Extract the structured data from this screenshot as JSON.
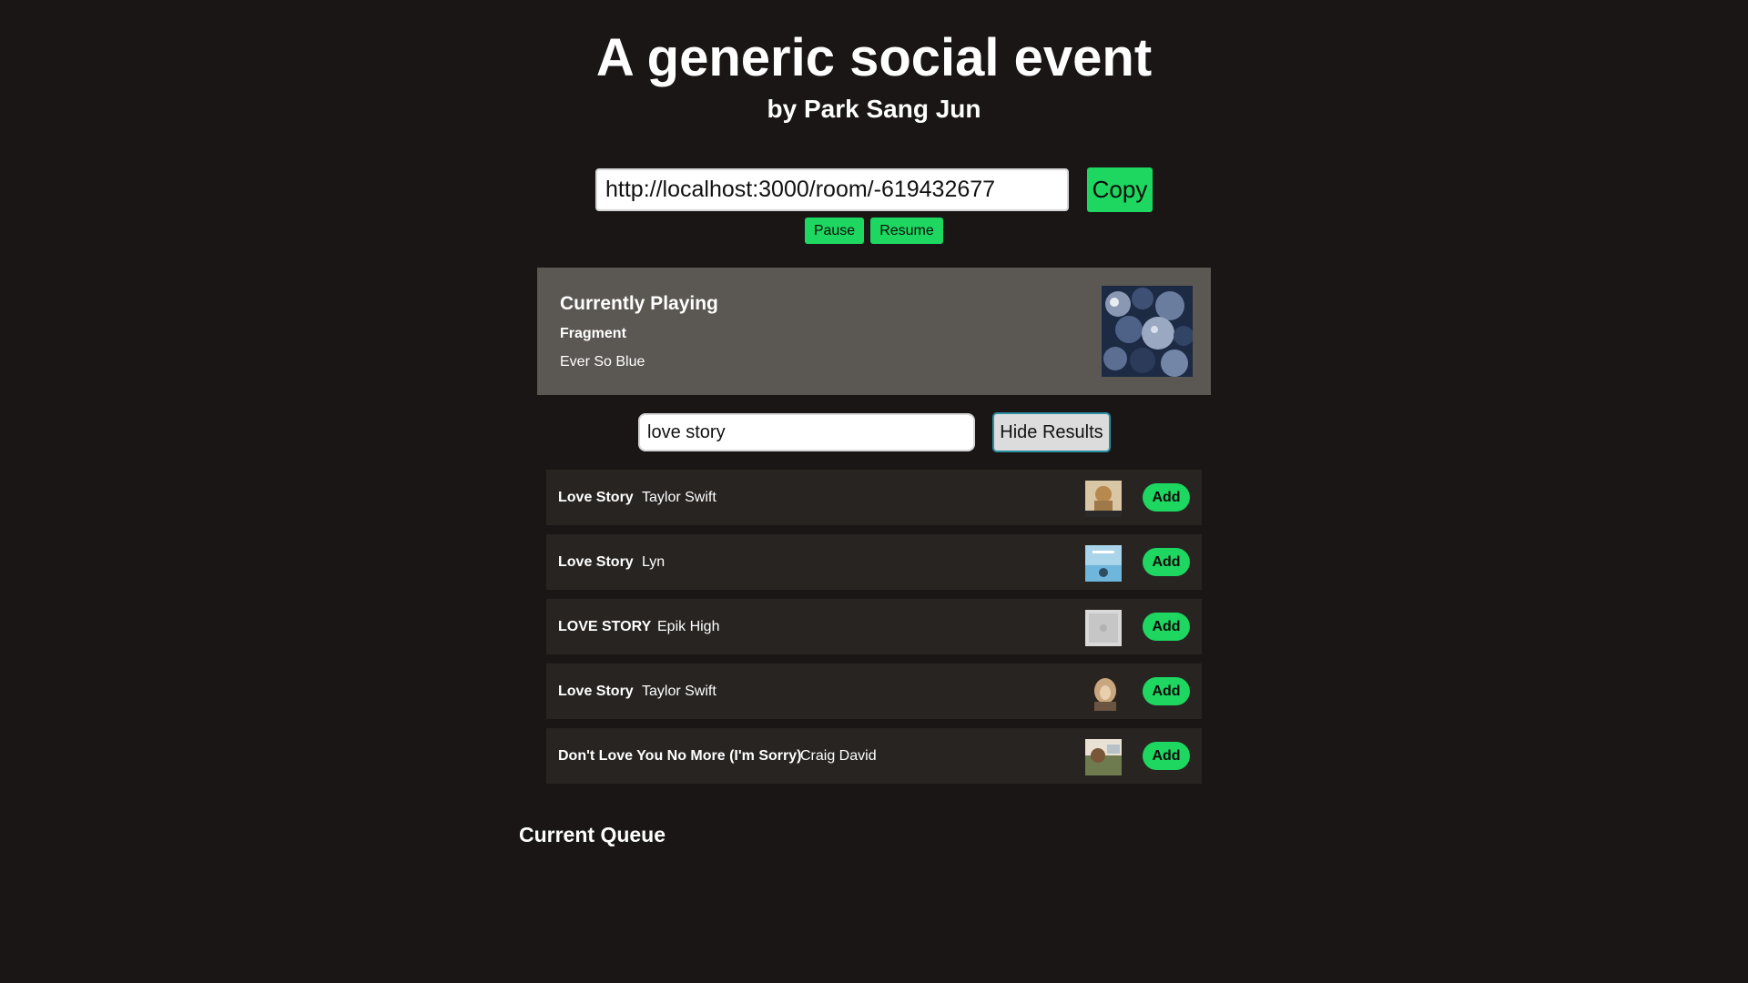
{
  "header": {
    "title": "A generic social event",
    "subtitle": "by Park Sang Jun"
  },
  "room": {
    "url_value": "http://localhost:3000/room/-619432677",
    "copy_label": "Copy",
    "pause_label": "Pause",
    "resume_label": "Resume"
  },
  "now_playing": {
    "heading": "Currently Playing",
    "track": "Fragment",
    "artist": "Ever So Blue"
  },
  "search": {
    "value": "love story",
    "hide_label": "Hide Results"
  },
  "results": [
    {
      "name": "Love Story",
      "artist": "Taylor Swift",
      "add_label": "Add"
    },
    {
      "name": "Love Story",
      "artist": "Lyn",
      "add_label": "Add"
    },
    {
      "name": "LOVE STORY",
      "artist": "Epik High",
      "add_label": "Add"
    },
    {
      "name": "Love Story",
      "artist": "Taylor Swift",
      "add_label": "Add"
    },
    {
      "name": "Don't Love You No More (I'm Sorry)",
      "artist": "Craig David",
      "add_label": "Add"
    }
  ],
  "queue": {
    "heading": "Current Queue"
  },
  "colors": {
    "background": "#191615",
    "accent": "#1ed760",
    "now_playing_panel": "#5b5752",
    "result_row": "#272422"
  }
}
